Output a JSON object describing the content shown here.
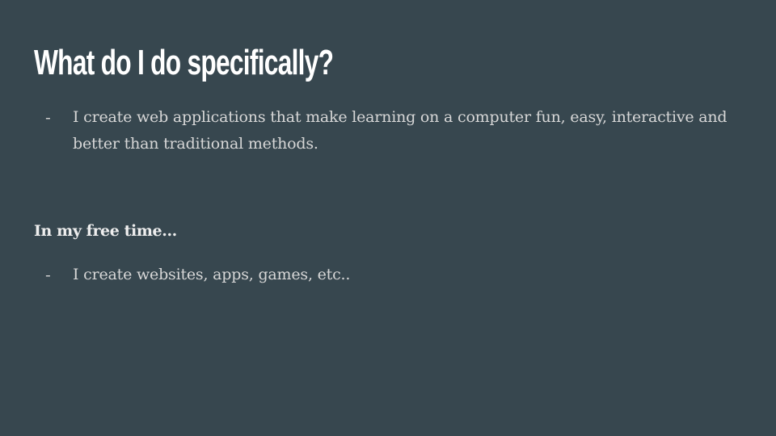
{
  "slide": {
    "title": "What do I do specifically?",
    "bullets_main": [
      {
        "dash": "-",
        "text": "I create web applications that make learning on a computer fun, easy, interactive and better than traditional methods."
      }
    ],
    "subheading": "In my free time...",
    "bullets_free_time": [
      {
        "dash": "-",
        "text": "I create websites, apps, games, etc.."
      }
    ]
  },
  "colors": {
    "background": "#37474f",
    "title": "#ffffff",
    "body_text": "#d7d7d7"
  }
}
